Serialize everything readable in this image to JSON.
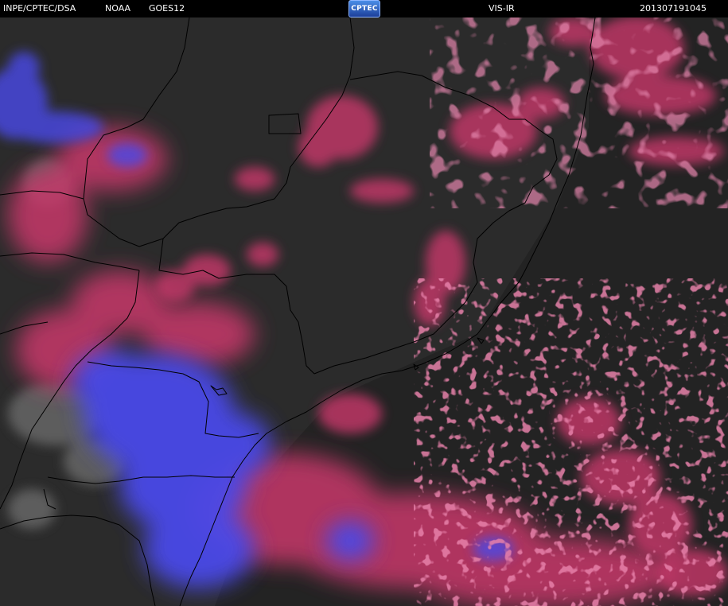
{
  "header": {
    "source": "INPE/CPTEC/DSA",
    "agency": "NOAA",
    "satellite": "GOES12",
    "logo_text": "CPTEC",
    "channel": "VIS-IR",
    "timestamp": "201307191045"
  },
  "colors": {
    "background": "#2b2b2b",
    "ir_cold_cloud": "#4848e8",
    "ir_mid_cloud": "#c8386a",
    "low_cloud_gray": "#707070",
    "borders": "#000000"
  }
}
